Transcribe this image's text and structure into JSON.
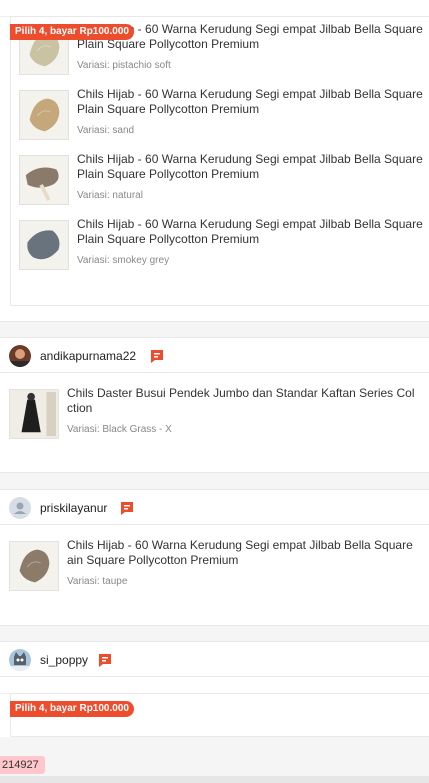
{
  "order_1": {
    "promo": "Pilih 4, bayar Rp100.000",
    "items": [
      {
        "name": "Chils Hijab - 60 Warna Kerudung Segi empat Jilbab Bella Square Plain Square Pollycotton Premium",
        "variant": "Variasi: pistachio soft",
        "color": "#c9c2a3"
      },
      {
        "name": "Chils Hijab - 60 Warna Kerudung Segi empat Jilbab Bella Square Plain Square Pollycotton Premium",
        "variant": "Variasi: sand",
        "color": "#c4a87c"
      },
      {
        "name": "Chils Hijab - 60 Warna Kerudung Segi empat Jilbab Bella Square Plain Square Pollycotton Premium",
        "variant": "Variasi: natural",
        "color": "#8a7a6a"
      },
      {
        "name": "Chils Hijab - 60 Warna Kerudung Segi empat Jilbab Bella Square Plain Square Pollycotton Premium",
        "variant": "Variasi: smokey grey",
        "color": "#68737d"
      }
    ]
  },
  "order_2": {
    "username": "andikapurnama22",
    "item": {
      "name": "Chils Daster Busui Pendek Jumbo dan Standar Kaftan Series Col ction",
      "variant": "Variasi: Black Grass - X"
    }
  },
  "order_3": {
    "username": "priskilayanur",
    "item": {
      "name": "Chils Hijab - 60 Warna Kerudung Segi empat Jilbab Bella Square ain Square Pollycotton Premium",
      "variant": "Variasi: taupe",
      "color": "#8c7b68"
    }
  },
  "order_4": {
    "username": "si_poppy",
    "promo": "Pilih 4, bayar Rp100.000"
  },
  "order_code": "214927",
  "colors": {
    "accent": "#ee4d2d",
    "chat": "#ee4d2d",
    "code_bg": "#ffc6cc"
  }
}
